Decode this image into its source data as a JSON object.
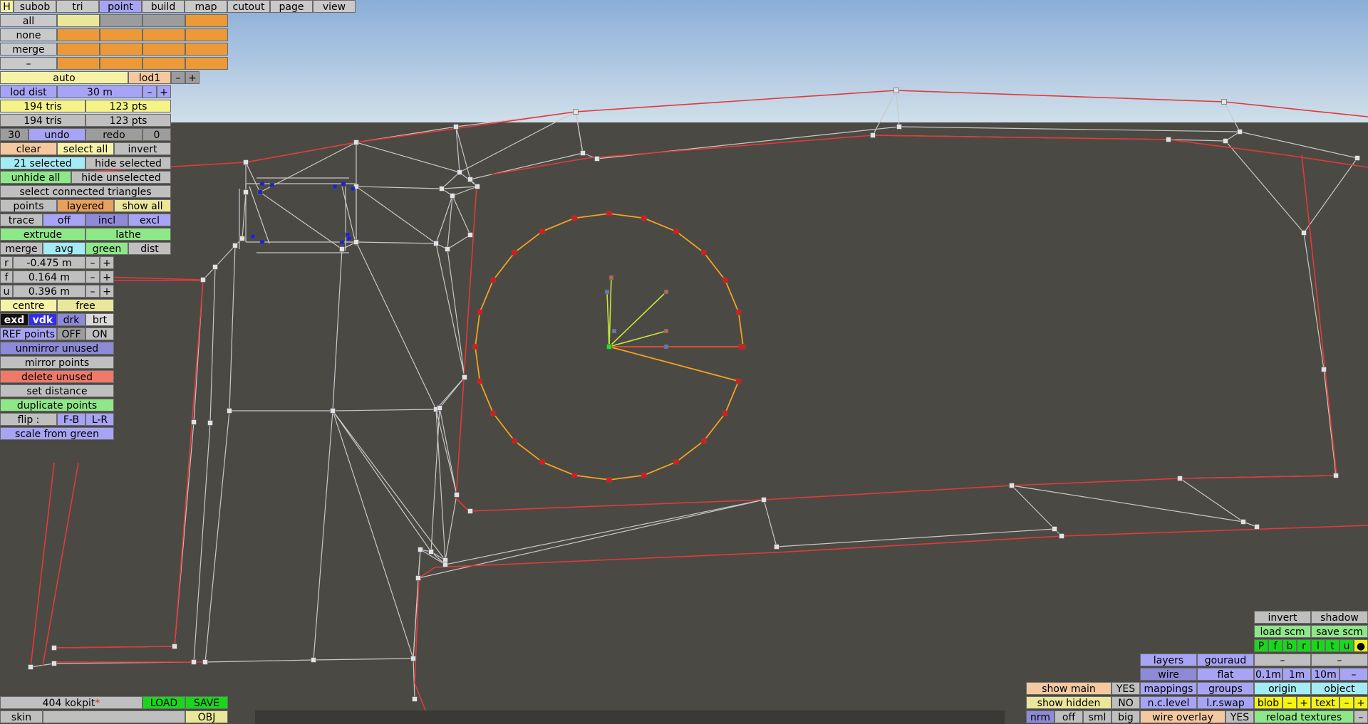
{
  "menu": {
    "h": "H",
    "tabs": [
      "subob",
      "tri",
      "point",
      "build",
      "map",
      "cutout",
      "page",
      "view"
    ],
    "active": "point"
  },
  "layers": {
    "rows": [
      "all",
      "none",
      "merge",
      "–"
    ]
  },
  "lod": {
    "auto": "auto",
    "level": "lod1",
    "minus": "–",
    "plus": "+",
    "dist_label": "lod dist",
    "dist_value": "30 m"
  },
  "stats": {
    "tris1": "194 tris",
    "pts1": "123 pts",
    "tris2": "194 tris",
    "pts2": "123 pts"
  },
  "undo": {
    "count": "30",
    "undo": "undo",
    "redo": "redo",
    "redo_count": "0"
  },
  "selection": {
    "clear": "clear",
    "select_all": "select all",
    "invert": "invert",
    "selected": "21 selected",
    "hide_selected": "hide selected",
    "unhide_all": "unhide all",
    "hide_unselected": "hide unselected",
    "select_connected": "select connected triangles"
  },
  "pointmode": {
    "points": "points",
    "layered": "layered",
    "show_all": "show all",
    "trace": "trace",
    "off": "off",
    "incl": "incl",
    "excl": "excl",
    "extrude": "extrude",
    "lathe": "lathe",
    "merge": "merge",
    "avg": "avg",
    "green": "green",
    "dist": "dist"
  },
  "coords": {
    "r_label": "r",
    "r_value": "-0.475 m",
    "f_label": "f",
    "f_value": "0.164 m",
    "u_label": "u",
    "u_value": "0.396 m",
    "minus": "–",
    "plus": "+"
  },
  "tools": {
    "centre": "centre",
    "free": "free",
    "exd": "exd",
    "vdk": "vdk",
    "drk": "drk",
    "brt": "brt",
    "ref_points": "REF points",
    "ref_off": "OFF",
    "ref_on": "ON",
    "unmirror_unused": "unmirror unused",
    "mirror_points": "mirror points",
    "delete_unused": "delete unused",
    "set_distance": "set distance",
    "duplicate_points": "duplicate points",
    "flip": "flip :",
    "flip_fb": "F-B",
    "flip_lr": "L-R",
    "scale_from_green": "scale from green"
  },
  "file": {
    "name": "404 kokpit",
    "modified": "*",
    "load": "LOAD",
    "save": "SAVE",
    "skin": "skin",
    "obj": "OBJ"
  },
  "display": {
    "show_main": "show main",
    "show_main_val": "YES",
    "show_hidden": "show hidden",
    "show_hidden_val": "NO",
    "nrm": "nrm",
    "off": "off",
    "sml": "sml",
    "big": "big",
    "layers": "layers",
    "gouraud": "gouraud",
    "wire": "wire",
    "flat": "flat",
    "mappings": "mappings",
    "groups": "groups",
    "nclevel": "n.c.level",
    "lrswap": "l.r.swap",
    "wire_overlay": "wire overlay",
    "wire_overlay_val": "YES"
  },
  "view": {
    "invert": "invert",
    "shadow": "shadow",
    "load_scm": "load scm",
    "save_scm": "save scm",
    "letters": [
      "P",
      "f",
      "b",
      "r",
      "l",
      "t",
      "u",
      "●"
    ],
    "dash1": "–",
    "dash2": "–",
    "d01": "0.1m",
    "d1": "1m",
    "d10": "10m",
    "dminus": "–",
    "origin": "origin",
    "object": "object",
    "blob": "blob",
    "text": "text",
    "minus": "–",
    "plus": "+",
    "reload": "reload textures",
    "reload_minus": "–"
  },
  "colors": {
    "background": "#4b4944",
    "sky_top": "#8aaed8",
    "sky_bottom": "#d0dfea",
    "wire": "#c8c8c8",
    "edge": "#e03a3a",
    "ring": "#f2a21e",
    "node": "#e0e0e0",
    "selected": "#e01818",
    "blue": "#2020d0"
  }
}
